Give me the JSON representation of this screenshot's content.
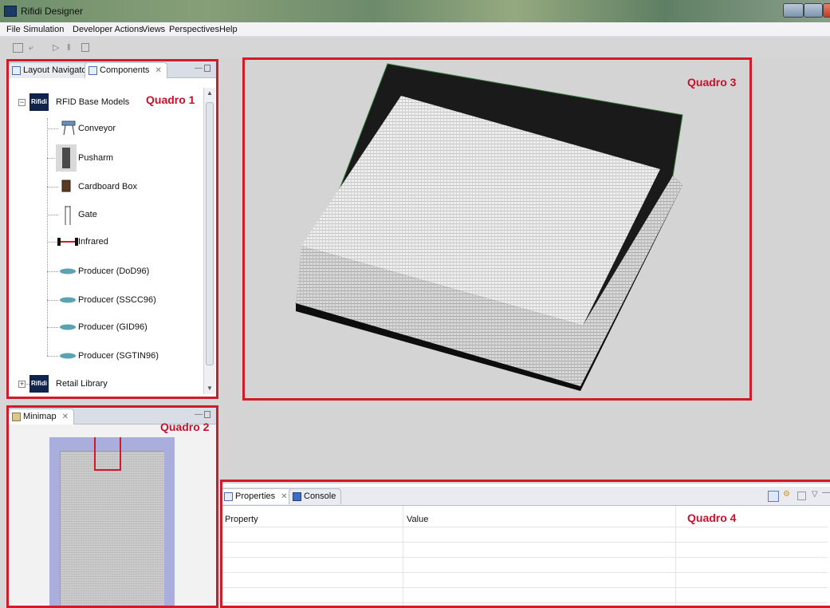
{
  "window": {
    "title": "Rifidi Designer"
  },
  "menu": [
    "File",
    "Simulation",
    "Developer Actions",
    "Views",
    "Perspectives",
    "Help"
  ],
  "components_panel": {
    "tabs": [
      "Layout Navigator",
      "Components"
    ],
    "root": "RFID Base Models",
    "items": [
      "Conveyor",
      "Pusharm",
      "Cardboard Box",
      "Gate",
      "Infrared",
      "Producer (DoD96)",
      "Producer (SSCC96)",
      "Producer (GID96)",
      "Producer (SGTIN96)"
    ],
    "library": "Retail Library",
    "logo_text": "Rifidi"
  },
  "minimap_panel": {
    "tab": "Minimap"
  },
  "bottom_panel": {
    "tabs": [
      "Properties",
      "Console"
    ],
    "columns": [
      "Property",
      "Value"
    ]
  },
  "annotations": {
    "q1": "Quadro 1",
    "q2": "Quadro 2",
    "q3": "Quadro 3",
    "q4": "Quadro 4"
  },
  "colors": {
    "annotation_red": "#d11a2a",
    "minimap_frame": "#a9aedd"
  }
}
